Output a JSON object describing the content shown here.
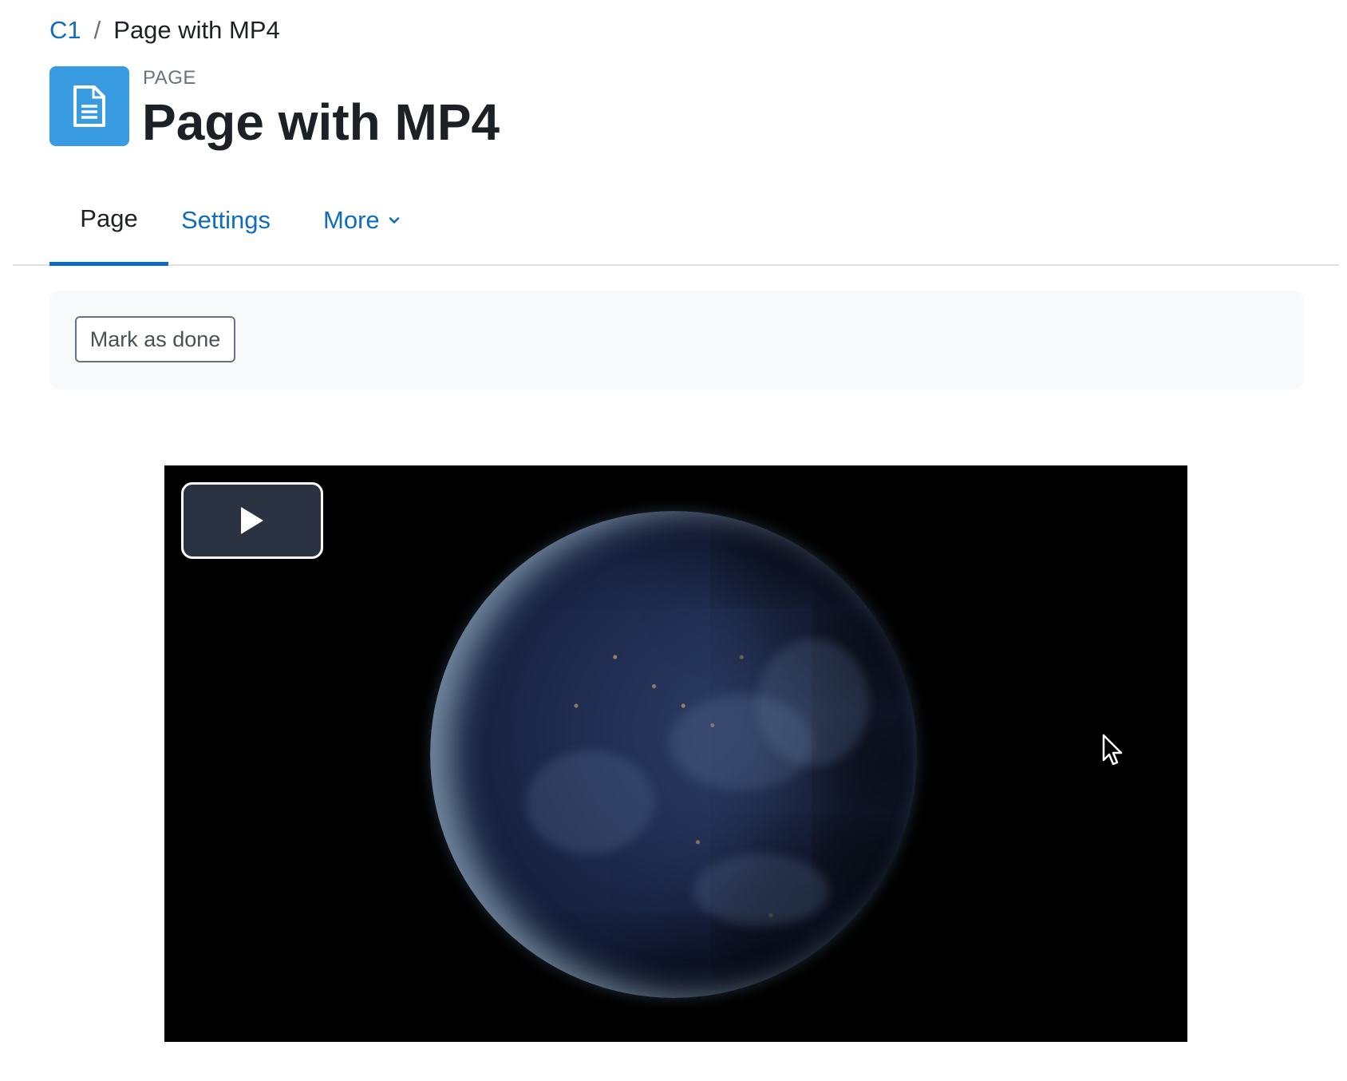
{
  "breadcrumb": {
    "course": "C1",
    "separator": "/",
    "current": "Page with MP4"
  },
  "header": {
    "activity_icon": "document-icon",
    "activity_kind": "PAGE",
    "title": "Page with MP4",
    "icon_color": "#399be2"
  },
  "tabs": [
    {
      "label": "Page",
      "active": true
    },
    {
      "label": "Settings",
      "active": false
    },
    {
      "label": "More",
      "active": false,
      "icon": "chevron-down-icon"
    }
  ],
  "completion": {
    "mark_done_label": "Mark as done"
  },
  "video": {
    "play_icon": "play-icon",
    "thumbnail": "earth-at-night-globe"
  },
  "colors": {
    "link": "#0f6cbf",
    "text": "#1d2125",
    "muted": "#6a737b",
    "panel_bg": "#f8f9fa"
  }
}
